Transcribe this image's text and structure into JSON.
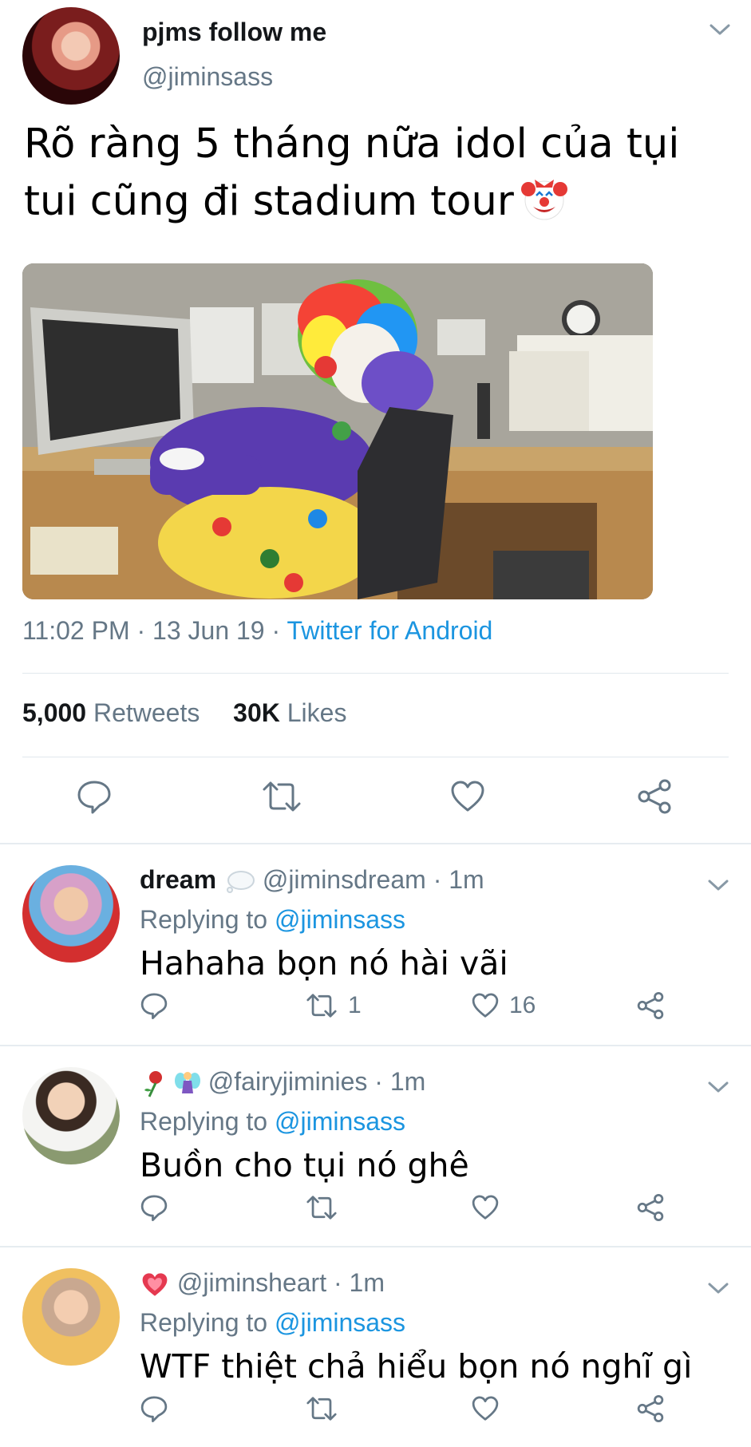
{
  "tweet": {
    "display_name": "pjms follow me",
    "handle": "@jiminsass",
    "text": "Rõ ràng 5 tháng nữa idol của tụi tui cũng đi stadium tour",
    "emoji": "clown-face",
    "time": "11:02 PM",
    "date": "13 Jun 19",
    "source": "Twitter for Android",
    "dot": "·",
    "retweets_count": "5,000",
    "retweets_label": "Retweets",
    "likes_count": "30K",
    "likes_label": "Likes"
  },
  "replies": [
    {
      "name": "dream",
      "name_emoji": "thought-balloon",
      "handle": "@jiminsdream",
      "time": "1m",
      "replying_label": "Replying to",
      "replying_to": "@jiminsass",
      "text": "Hahaha bọn nó hài vãi",
      "retweets": "1",
      "likes": "16"
    },
    {
      "name": "",
      "name_emoji": "rose-fairy",
      "handle": "@fairyjiminies",
      "time": "1m",
      "replying_label": "Replying to",
      "replying_to": "@jiminsass",
      "text": "Buồn cho tụi nó ghê",
      "retweets": "",
      "likes": ""
    },
    {
      "name": "",
      "name_emoji": "heart",
      "handle": "@jiminsheart",
      "time": "1m",
      "replying_label": "Replying to",
      "replying_to": "@jiminsass",
      "text": "WTF thiệt chả hiểu bọn nó nghĩ gì",
      "retweets": "",
      "likes": ""
    }
  ],
  "colors": {
    "link": "#1b95e0",
    "secondary": "#657786",
    "primary": "#14171a",
    "divider": "#e1e8ed"
  }
}
